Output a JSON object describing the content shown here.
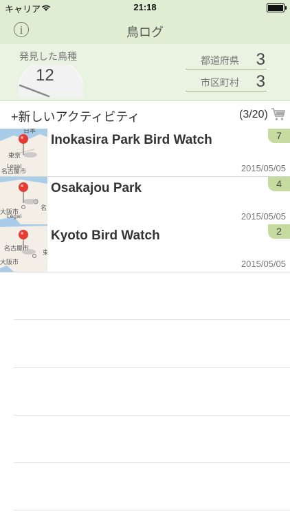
{
  "status": {
    "carrier": "キャリア",
    "time": "21:18"
  },
  "nav": {
    "title": "鳥ログ",
    "info_icon": "i"
  },
  "summary": {
    "found_label": "発見した鳥種",
    "found_count": "12",
    "prefectures_label": "都道府県",
    "prefectures_count": "3",
    "cities_label": "市区町村",
    "cities_count": "3"
  },
  "new_activity": {
    "label": "+新しいアクティビティ",
    "count": "(3/20)"
  },
  "activities": [
    {
      "name": "Inokasira Park Bird Watch",
      "date": "2015/05/05",
      "badge": "7",
      "map_labels": [
        "日本",
        "東京",
        "Legal",
        "名古屋市"
      ]
    },
    {
      "name": "Osakajou Park",
      "date": "2015/05/05",
      "badge": "4",
      "map_labels": [
        "大阪市",
        "Legal",
        "名"
      ]
    },
    {
      "name": "Kyoto Bird Watch",
      "date": "2015/05/05",
      "badge": "2",
      "map_labels": [
        "名古屋市",
        "大阪市",
        "東"
      ]
    }
  ],
  "colors": {
    "header_bg": "#dfeed3",
    "summary_bg": "#eaf3e1",
    "badge_bg": "#c6db9f",
    "pin": "#e53b33",
    "map_water": "#a9cde9",
    "map_land": "#f3efe6"
  }
}
